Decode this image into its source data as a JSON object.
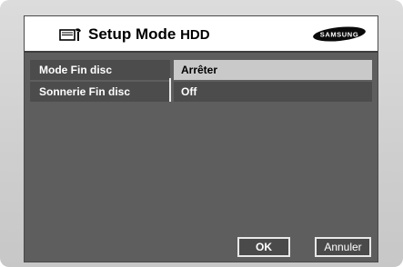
{
  "header": {
    "title": "Setup Mode",
    "mode": "HDD",
    "brand": "SAMSUNG",
    "icon": "setup-tool-icon"
  },
  "settings": [
    {
      "label": "Mode Fin disc",
      "value": "Arrêter",
      "selected": true
    },
    {
      "label": "Sonnerie Fin disc",
      "value": "Off",
      "selected": false
    }
  ],
  "buttons": {
    "ok": "OK",
    "cancel": "Annuler"
  },
  "colors": {
    "panel": "#5e5e5e",
    "row": "#4c4c4c",
    "selected": "#c9c9c9"
  }
}
